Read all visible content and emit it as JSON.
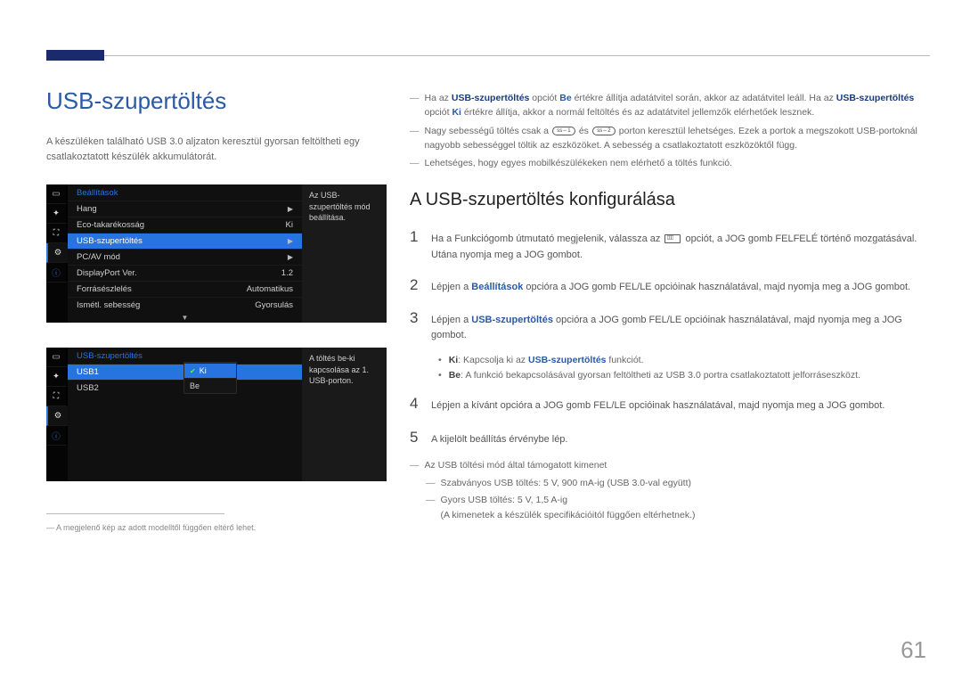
{
  "page_number": "61",
  "left": {
    "title": "USB-szupertöltés",
    "intro": "A készüléken található USB 3.0 aljzaton keresztül gyorsan feltöltheti egy csatlakoztatott készülék akkumulátorát.",
    "footnote": "― A megjelenő kép az adott modelltől függően eltérő lehet."
  },
  "osd1": {
    "header": "Beállítások",
    "help": "Az USB-szupertöltés mód beállítása.",
    "rows": [
      {
        "label": "Hang",
        "value": "",
        "arrow": true
      },
      {
        "label": "Eco-takarékosság",
        "value": "Ki"
      },
      {
        "label": "USB-szupertöltés",
        "value": "",
        "arrow": true,
        "selected": true
      },
      {
        "label": "PC/AV mód",
        "value": "",
        "arrow": true
      },
      {
        "label": "DisplayPort Ver.",
        "value": "1.2"
      },
      {
        "label": "Forrásészlelés",
        "value": "Automatikus"
      },
      {
        "label": "Ismétl. sebesség",
        "value": "Gyorsulás"
      }
    ]
  },
  "osd2": {
    "header": "USB-szupertöltés",
    "help": "A töltés be-ki kapcsolása az 1. USB-porton.",
    "rows": [
      {
        "label": "USB1",
        "selected": true
      },
      {
        "label": "USB2"
      }
    ],
    "options": [
      {
        "label": "Ki",
        "selected": true
      },
      {
        "label": "Be"
      }
    ]
  },
  "right": {
    "notes": [
      {
        "prefix": "Ha az ",
        "bold1": "USB-szupertöltés",
        "mid1": " opciót ",
        "v1": "Be",
        "mid2": " értékre állítja adatátvitel során, akkor az adatátvitel leáll. Ha az ",
        "bold2": "USB-szupertöltés",
        "mid3": " opciót ",
        "v2": "Ki",
        "tail": " értékre állítja, akkor a normál feltöltés és az adatátvitel jellemzők elérhetőek lesznek."
      },
      {
        "text_a": "Nagy sebességű töltés csak a ",
        "port1": "1",
        "text_b": " és ",
        "port2": "2",
        "text_c": " porton keresztül lehetséges. Ezek a portok a megszokott USB-portoknál nagyobb sebességgel töltik az eszközöket. A sebesség a csatlakoztatott eszközöktől függ."
      },
      {
        "text": "Lehetséges, hogy egyes mobilkészülékeken nem elérhető a töltés funkció."
      }
    ],
    "heading": "A USB-szupertöltés konfigurálása",
    "steps": [
      {
        "n": "1",
        "pre": "Ha a Funkciógomb útmutató megjelenik, válassza az ",
        "post": " opciót, a JOG gomb FELFELÉ történő mozgatásával. Utána nyomja meg a JOG gombot.",
        "icon": true
      },
      {
        "n": "2",
        "pre": "Lépjen a ",
        "bold": "Beállítások",
        "post": " opcióra a JOG gomb FEL/LE opcióinak használatával, majd nyomja meg a JOG gombot."
      },
      {
        "n": "3",
        "pre": "Lépjen a ",
        "bold": "USB-szupertöltés",
        "post": " opcióra a JOG gomb FEL/LE opcióinak használatával, majd nyomja meg a JOG gombot.",
        "bullets": [
          {
            "k": "Ki",
            "t": ": Kapcsolja ki az ",
            "b": "USB-szupertöltés",
            "e": " funkciót."
          },
          {
            "k": "Be",
            "t": ": A funkció bekapcsolásával gyorsan feltöltheti az USB 3.0 portra csatlakoztatott jelforráseszközt."
          }
        ]
      },
      {
        "n": "4",
        "text": "Lépjen a kívánt opcióra a JOG gomb FEL/LE opcióinak használatával, majd nyomja meg a JOG gombot."
      },
      {
        "n": "5",
        "text": "A kijelölt beállítás érvénybe lép."
      }
    ],
    "output_head": "Az USB töltési mód által támogatott kimenet",
    "output_items": [
      "Szabványos USB töltés: 5 V, 900 mA-ig (USB 3.0-val együtt)",
      "Gyors USB töltés: 5 V, 1,5 A-ig"
    ],
    "output_note": "(A kimenetek a készülék specifikációitól függően eltérhetnek.)"
  }
}
